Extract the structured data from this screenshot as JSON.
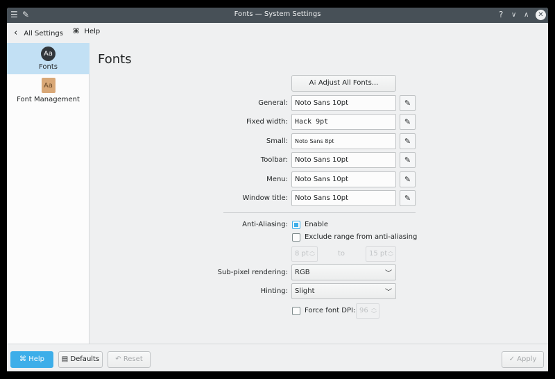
{
  "window": {
    "title": "Fonts — System Settings"
  },
  "toolbar": {
    "back_label": "All Settings",
    "help_label": "Help"
  },
  "sidebar": {
    "items": [
      {
        "label": "Fonts",
        "icon": "Aa"
      },
      {
        "label": "Font Management",
        "icon": "Aa"
      }
    ]
  },
  "main": {
    "heading": "Fonts",
    "adjust_all": "Adjust All Fonts...",
    "fonts": [
      {
        "label": "General:",
        "value": "Noto Sans 10pt"
      },
      {
        "label": "Fixed width:",
        "value": "Hack 9pt"
      },
      {
        "label": "Small:",
        "value": "Noto Sans 8pt"
      },
      {
        "label": "Toolbar:",
        "value": "Noto Sans 10pt"
      },
      {
        "label": "Menu:",
        "value": "Noto Sans 10pt"
      },
      {
        "label": "Window title:",
        "value": "Noto Sans 10pt"
      }
    ],
    "antialiasing": {
      "label": "Anti-Aliasing:",
      "enable_label": "Enable",
      "enabled": true,
      "exclude_label": "Exclude range from anti-aliasing",
      "exclude": false,
      "from": "8 pt",
      "to_label": "to",
      "to": "15 pt"
    },
    "subpixel": {
      "label": "Sub-pixel rendering:",
      "value": "RGB"
    },
    "hinting": {
      "label": "Hinting:",
      "value": "Slight"
    },
    "dpi": {
      "label": "Force font DPI:",
      "checked": false,
      "value": "96"
    }
  },
  "footer": {
    "help": "Help",
    "defaults": "Defaults",
    "reset": "Reset",
    "apply": "Apply"
  },
  "colors": {
    "accent": "#3daee9",
    "titlebar": "#475057"
  }
}
